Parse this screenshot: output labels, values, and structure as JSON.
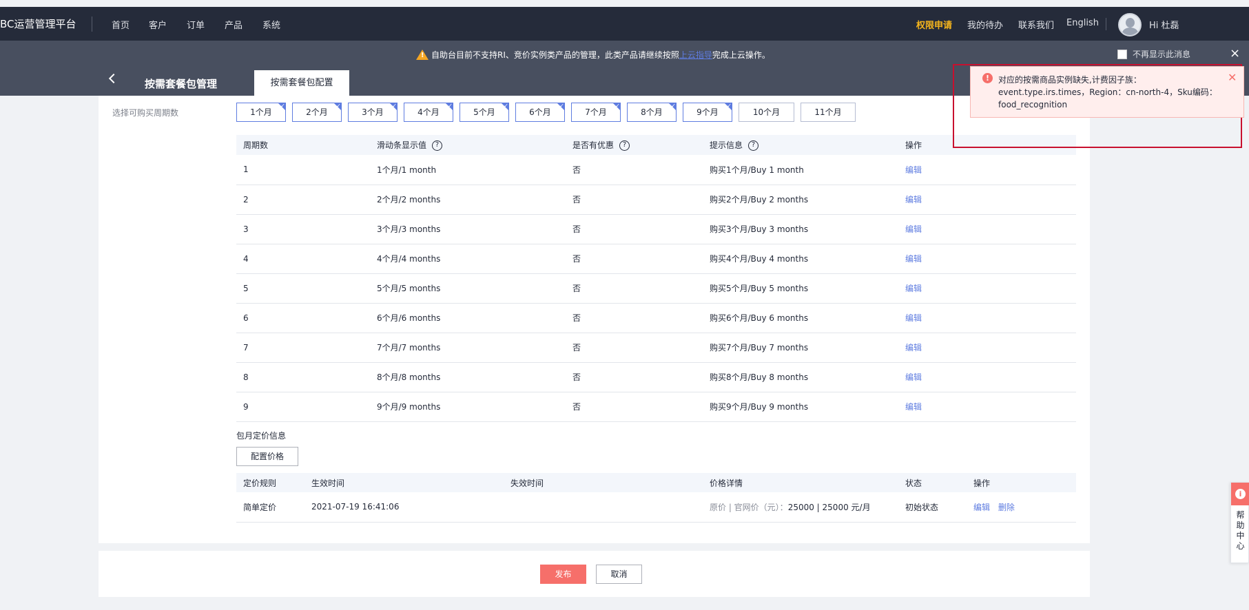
{
  "topbar": {
    "brand": "BC运营管理平台",
    "nav": [
      "首页",
      "客户",
      "订单",
      "产品",
      "系统"
    ],
    "right": {
      "permission": "权限申请",
      "todo": "我的待办",
      "contact": "联系我们",
      "language": "English",
      "greeting": "Hi 杜磊"
    }
  },
  "notice": {
    "text_before": "自助台目前不支持RI、竞价实例类产品的管理，此类产品请继续按照",
    "link": "上云指导",
    "text_after": "完成上云操作。",
    "no_show": "不再显示此消息",
    "close": "×"
  },
  "header": {
    "title": "按需套餐包管理",
    "tab": "按需套餐包配置"
  },
  "form": {
    "period_label": "选择可购买周期数",
    "months": [
      {
        "label": "1个月",
        "selected": true
      },
      {
        "label": "2个月",
        "selected": true
      },
      {
        "label": "3个月",
        "selected": true
      },
      {
        "label": "4个月",
        "selected": true
      },
      {
        "label": "5个月",
        "selected": true
      },
      {
        "label": "6个月",
        "selected": true
      },
      {
        "label": "7个月",
        "selected": true
      },
      {
        "label": "8个月",
        "selected": true
      },
      {
        "label": "9个月",
        "selected": true
      },
      {
        "label": "10个月",
        "selected": false
      },
      {
        "label": "11个月",
        "selected": false
      }
    ]
  },
  "period_table": {
    "headers": [
      "周期数",
      "滑动条显示值",
      "是否有优惠",
      "提示信息",
      "操作"
    ],
    "help": "?",
    "rows": [
      {
        "n": "1",
        "display": "1个月/1 month",
        "discount": "否",
        "tip": "购买1个月/Buy 1 month",
        "action": "编辑"
      },
      {
        "n": "2",
        "display": "2个月/2 months",
        "discount": "否",
        "tip": "购买2个月/Buy 2 months",
        "action": "编辑"
      },
      {
        "n": "3",
        "display": "3个月/3 months",
        "discount": "否",
        "tip": "购买3个月/Buy 3 months",
        "action": "编辑"
      },
      {
        "n": "4",
        "display": "4个月/4 months",
        "discount": "否",
        "tip": "购买4个月/Buy 4 months",
        "action": "编辑"
      },
      {
        "n": "5",
        "display": "5个月/5 months",
        "discount": "否",
        "tip": "购买5个月/Buy 5 months",
        "action": "编辑"
      },
      {
        "n": "6",
        "display": "6个月/6 months",
        "discount": "否",
        "tip": "购买6个月/Buy 6 months",
        "action": "编辑"
      },
      {
        "n": "7",
        "display": "7个月/7 months",
        "discount": "否",
        "tip": "购买7个月/Buy 7 months",
        "action": "编辑"
      },
      {
        "n": "8",
        "display": "8个月/8 months",
        "discount": "否",
        "tip": "购买8个月/Buy 8 months",
        "action": "编辑"
      },
      {
        "n": "9",
        "display": "9个月/9 months",
        "discount": "否",
        "tip": "购买9个月/Buy 9 months",
        "action": "编辑"
      }
    ]
  },
  "pricing": {
    "section_label": "包月定价信息",
    "config_button": "配置价格",
    "headers": [
      "定价规则",
      "生效时间",
      "失效时间",
      "价格详情",
      "状态",
      "操作"
    ],
    "row": {
      "rule": "简单定价",
      "start": "2021-07-19 16:41:06",
      "end": "",
      "price_prefix": "原价 | 官网价（元）：",
      "price_value": "25000 | 25000 元/月",
      "status": "初始状态",
      "edit": "编辑",
      "delete": "删除"
    }
  },
  "footer": {
    "publish": "发布",
    "cancel": "取消"
  },
  "toast": {
    "icon": "!",
    "lines": [
      "对应的按需商品实例缺失,计费因子族：",
      "event.type.irs.times，Region：cn-north-4，Sku编码：",
      "food_recognition"
    ],
    "close": "✕"
  },
  "help_widget": {
    "icon": "i",
    "chars": [
      "帮",
      "助",
      "中",
      "心"
    ]
  },
  "colors": {
    "topbar_bg": "#252b3a",
    "subheader_bg": "#484f5f",
    "accent": "#5e7ce0",
    "danger": "#f66f6a",
    "highlight": "#f5b51d"
  }
}
